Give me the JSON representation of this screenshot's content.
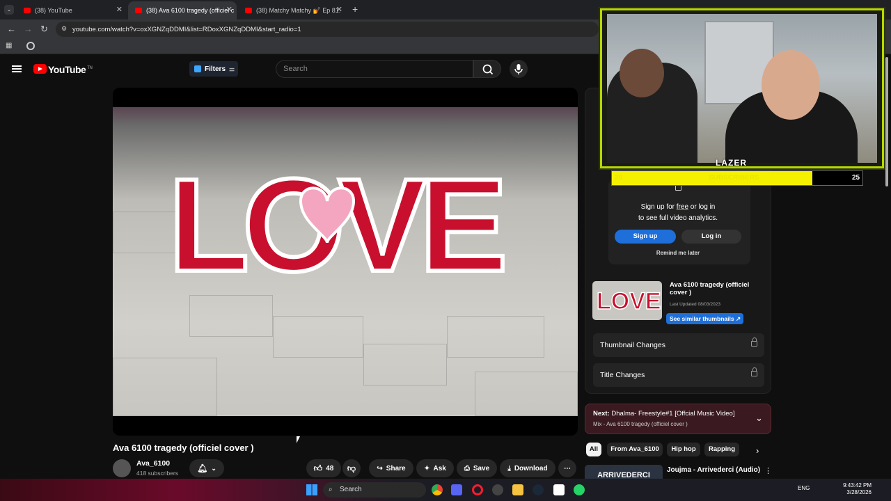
{
  "browser": {
    "tabs": [
      {
        "label": "(38) YouTube"
      },
      {
        "label": "(38) Ava 6100 tragedy (officiel c"
      },
      {
        "label": "(38) Matchy Matchy 💅 Ep 81:"
      }
    ],
    "new_tab": "+",
    "url": "youtube.com/watch?v=oxXGNZqDDMI&list=RDoxXGNZqDDMI&start_radio=1"
  },
  "youtube": {
    "logo_text": "YouTube",
    "logo_sup": "TN",
    "filters_label": "Filters",
    "search_placeholder": "Search"
  },
  "video": {
    "title": "Ava 6100 tragedy (officiel cover )",
    "graffiti_text": "LOVE",
    "channel_name": "Ava_6100",
    "subscribers": "418 subscribers",
    "like_count": "48",
    "share_label": "Share",
    "ask_label": "Ask",
    "save_label": "Save",
    "download_label": "Download"
  },
  "sidebar": {
    "popup_line1_pre": "Sign up for ",
    "popup_line1_link": "free",
    "popup_line1_post": " or log in",
    "popup_line2": "to see full video analytics.",
    "signup_label": "Sign up",
    "login_label": "Log in",
    "remind_label": "Remind me later",
    "card_title": "Ava 6100 tragedy (officiel cover )",
    "card_date": "Last Updated 08/03/2023",
    "similar_label": "See similar thumbnails ↗",
    "thumbnail_changes": "Thumbnail Changes",
    "title_changes": "Title Changes",
    "next_prefix": "Next:",
    "next_title": "Dhalma- Freestyle#1 [Offcial Music Video]",
    "next_sub": "Mix - Ava 6100 tragedy (officiel cover )",
    "chips": [
      "All",
      "From Ava_6100",
      "Hip hop",
      "Rapping"
    ],
    "rec_thumb_text": "ARRIVEDERCI",
    "rec_title": "Joujma - Arrivederci (Audio)"
  },
  "overlay": {
    "brand": "LAZER",
    "subs_current": "20",
    "subs_label": "SUBSCRIBERS",
    "subs_goal": "25",
    "progress_fraction": 0.8
  },
  "taskbar": {
    "search_label": "Search",
    "lang": "ENG",
    "time": "9:43:42 PM",
    "date": "3/28/2026"
  },
  "colors": {
    "yt_red": "#ff0000",
    "accent_blue": "#1e6fd9",
    "overlay_green": "#b8d600",
    "overlay_yellow": "#f5f000"
  }
}
